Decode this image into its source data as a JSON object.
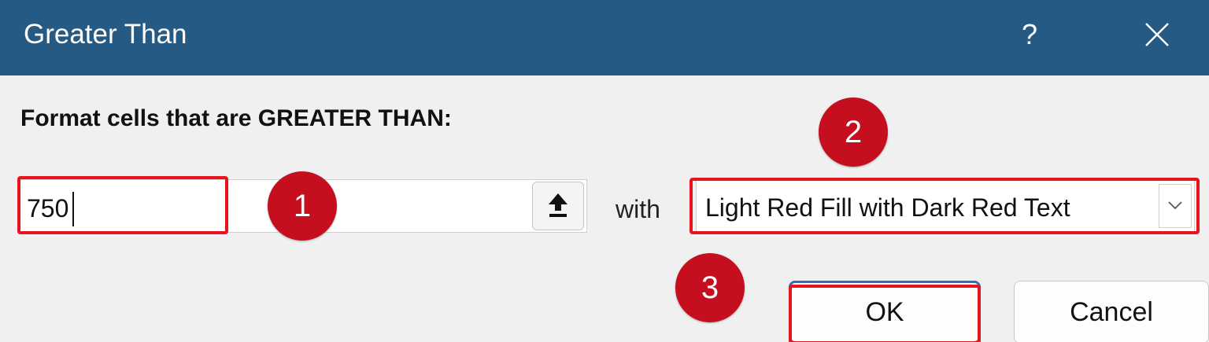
{
  "dialog": {
    "title": "Greater Than",
    "help_label": "?",
    "prompt": "Format cells that are GREATER THAN:",
    "value_input": {
      "value": "750"
    },
    "with_label": "with",
    "format_select": {
      "selected": "Light Red Fill with Dark Red Text"
    },
    "ok_label": "OK",
    "cancel_label": "Cancel"
  },
  "annotations": {
    "step1": "1",
    "step2": "2",
    "step3": "3"
  },
  "icons": {
    "close": "close-icon",
    "collapse": "collapse-dialog-icon",
    "dropdown": "chevron-down-icon"
  },
  "colors": {
    "titlebar": "#245a83",
    "highlight": "#e8141d",
    "marker": "#c50f1f",
    "ok_border": "#2f6fc0"
  }
}
